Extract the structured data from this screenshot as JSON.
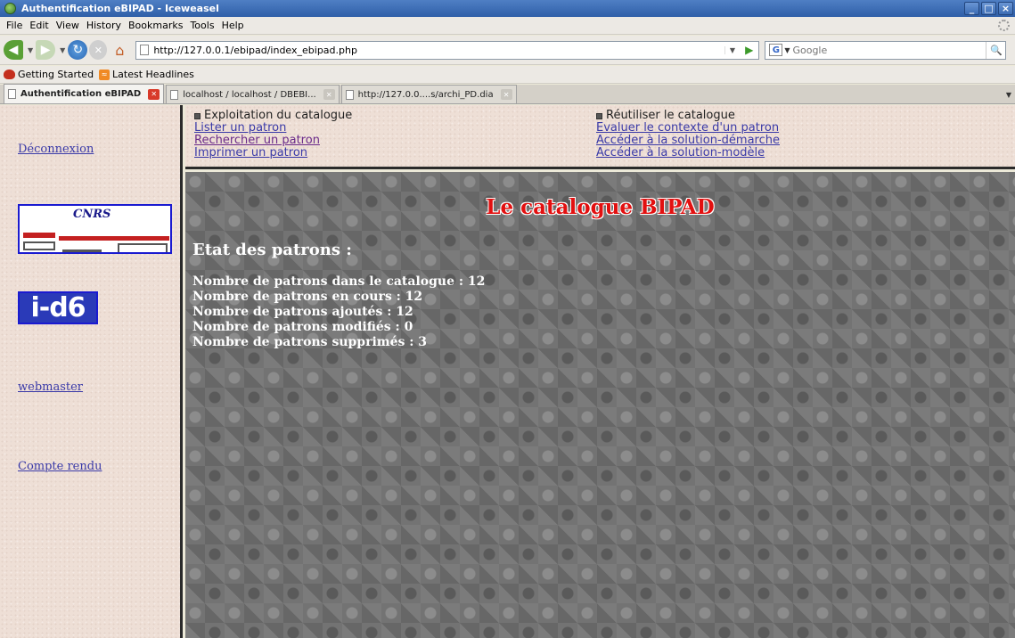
{
  "window": {
    "title": "Authentification eBIPAD - Iceweasel",
    "buttons": {
      "minimize": "_",
      "maximize": "□",
      "close": "×"
    }
  },
  "menubar": {
    "items": [
      {
        "label": "File",
        "accel": "F"
      },
      {
        "label": "Edit",
        "accel": "E"
      },
      {
        "label": "View",
        "accel": "V"
      },
      {
        "label": "History",
        "accel": "s"
      },
      {
        "label": "Bookmarks",
        "accel": "B"
      },
      {
        "label": "Tools",
        "accel": "T"
      },
      {
        "label": "Help",
        "accel": "H"
      }
    ]
  },
  "navbar": {
    "url": "http://127.0.0.1/ebipad/index_ebipad.php",
    "search_engine_icon": "G",
    "search_placeholder": "Google"
  },
  "bookmarks": [
    {
      "label": "Getting Started",
      "icon": "firefox-icon"
    },
    {
      "label": "Latest Headlines",
      "icon": "rss-icon"
    }
  ],
  "tabs": [
    {
      "label": "Authentification eBIPAD",
      "active": true
    },
    {
      "label": "localhost / localhost / DBEBI...",
      "active": false
    },
    {
      "label": "http://127.0.0....s/archi_PD.dia",
      "active": false
    }
  ],
  "sidebar": {
    "logout": "Déconnexion",
    "logo_cnrs_text": "CNRS",
    "logo_id6_text": "i-d6",
    "webmaster": "webmaster",
    "report": "Compte rendu"
  },
  "topmenu": {
    "exploit": {
      "heading": "Exploitation du catalogue",
      "links": [
        "Lister un patron",
        "Rechercher un patron",
        "Imprimer un patron"
      ]
    },
    "reuse": {
      "heading": "Réutiliser le catalogue",
      "links": [
        "Evaluer le contexte d'un patron",
        "Accéder à la solution-démarche",
        "Accéder à la solution-modèle"
      ]
    }
  },
  "main": {
    "title": "Le catalogue BIPAD",
    "state_heading": "Etat des patrons :",
    "stats": [
      "Nombre de patrons dans le catalogue : 12",
      "Nombre de patrons en cours : 12",
      "Nombre de patrons ajoutés : 12",
      "Nombre de patrons modifiés : 0",
      "Nombre de patrons supprimés : 3"
    ]
  }
}
